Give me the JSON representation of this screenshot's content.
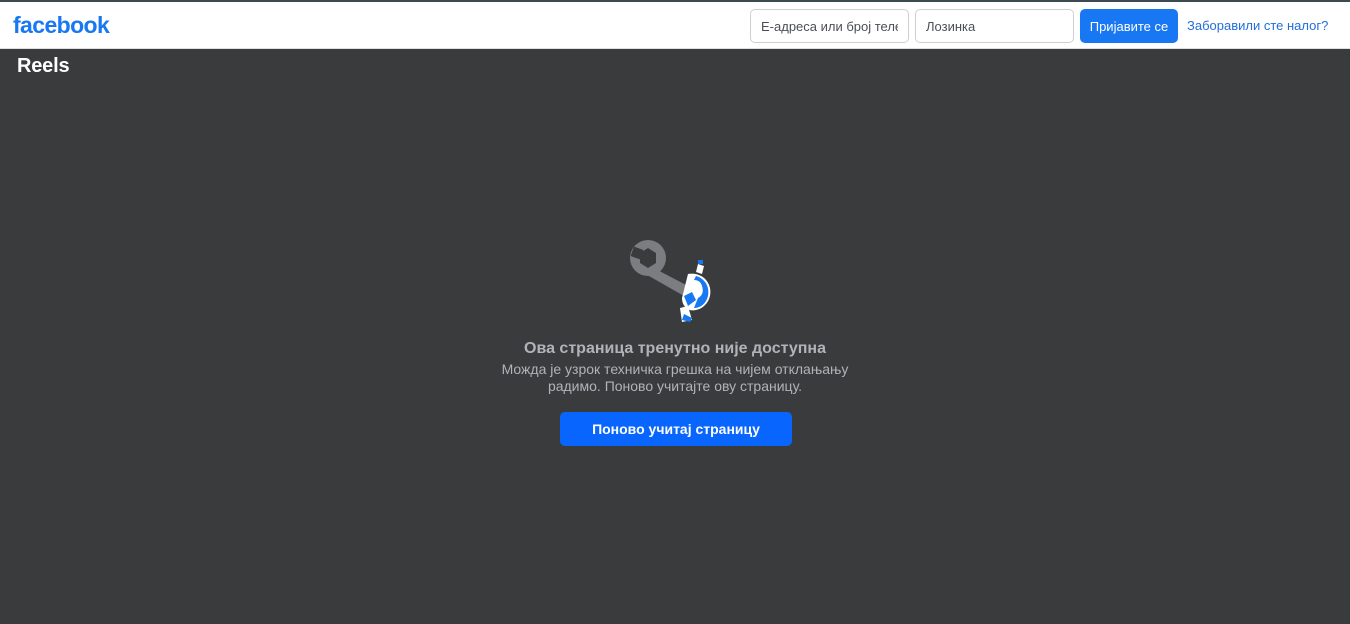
{
  "header": {
    "logo_text": "facebook",
    "email_placeholder": "Е-адреса или број теле",
    "password_placeholder": "Лозинка",
    "login_label": "Пријавите се",
    "forgot_label": "Заборавили сте налог?"
  },
  "section": {
    "title": "Reels"
  },
  "error": {
    "icon": "wrench-broken-icon",
    "title": "Ова страница тренутно није доступна",
    "description": "Можда је узрок техничка грешка на чијем отклањању радимо. Поново учитајте ову страницу.",
    "reload_label": "Поново учитај страницу"
  },
  "colors": {
    "brand": "#1877f2",
    "background": "#3a3b3c",
    "reload_button": "#0866ff"
  }
}
